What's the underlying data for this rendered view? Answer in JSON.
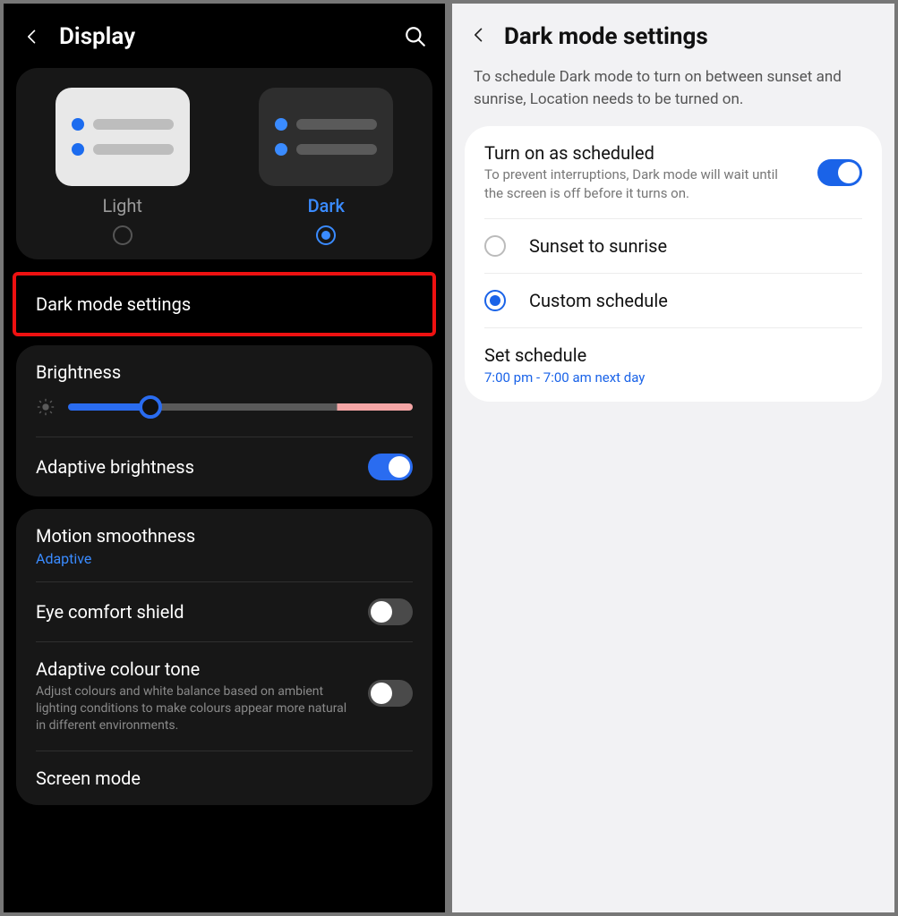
{
  "left": {
    "header_title": "Display",
    "theme": {
      "light_label": "Light",
      "dark_label": "Dark"
    },
    "dark_mode_settings_label": "Dark mode settings",
    "brightness_label": "Brightness",
    "adaptive_brightness_label": "Adaptive brightness",
    "motion_smoothness_label": "Motion smoothness",
    "motion_smoothness_value": "Adaptive",
    "eye_comfort_label": "Eye comfort shield",
    "adaptive_colour_label": "Adaptive colour tone",
    "adaptive_colour_desc": "Adjust colours and white balance based on ambient lighting conditions to make colours appear more natural in different environments.",
    "screen_mode_label": "Screen mode"
  },
  "right": {
    "header_title": "Dark mode settings",
    "description": "To schedule Dark mode to turn on between sunset and sunrise, Location needs to be turned on.",
    "schedule_title": "Turn on as scheduled",
    "schedule_desc": "To prevent interruptions, Dark mode will wait until the screen is off before it turns on.",
    "opt_sunset": "Sunset to sunrise",
    "opt_custom": "Custom schedule",
    "set_schedule_label": "Set schedule",
    "set_schedule_value": "7:00 pm - 7:00 am next day"
  }
}
